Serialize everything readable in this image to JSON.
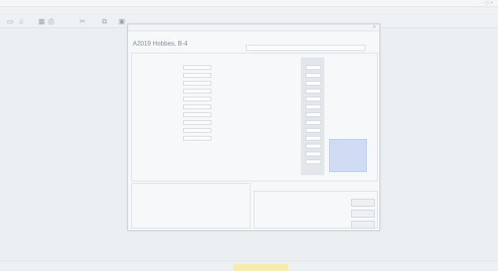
{
  "window": {
    "title": "",
    "controls": "–  ▢  ✕"
  },
  "menu": [],
  "toolbar": {
    "icons": [
      "new-icon",
      "open-icon",
      "save-icon",
      "print-icon",
      "cut-icon",
      "copy-icon",
      "paste-icon"
    ],
    "glyphs": [
      "▭",
      "⌂",
      "▦",
      "⎙",
      "✂",
      "⧉",
      "▣"
    ]
  },
  "dialog": {
    "title": "",
    "subheading": "",
    "heading": "A2019 Hobbes, B-4",
    "close": "✕",
    "columns": [
      "",
      "",
      "",
      "",
      "",
      "",
      ""
    ],
    "rows": []
  },
  "statusbar": {
    "items": [
      "",
      "",
      "",
      "",
      ""
    ]
  },
  "colors": {
    "workspace": "#eceff2",
    "dialog_bg": "#f7f8fa",
    "status_highlight": "#f6ebb0",
    "selection": "#cfdcf3"
  }
}
